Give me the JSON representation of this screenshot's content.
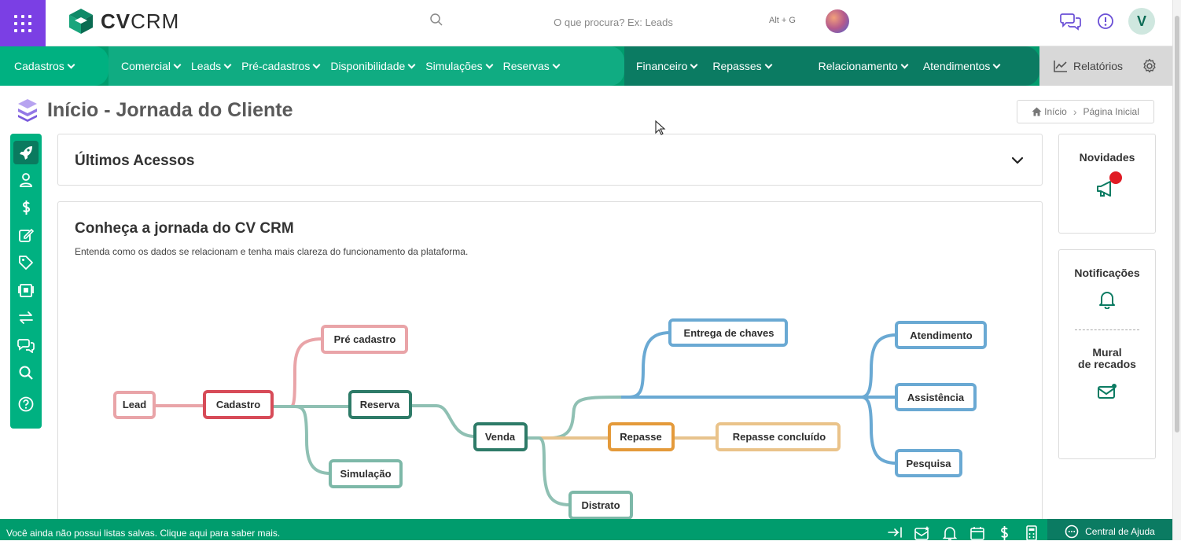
{
  "header": {
    "logo_text_bold": "CV",
    "logo_text": "CRM",
    "search_placeholder": "O que procura? Ex: Leads",
    "search_shortcut": "Alt + G",
    "user_initial": "V",
    "icons": [
      "apps-grid-icon",
      "search-icon",
      "chat-icon",
      "info-icon"
    ]
  },
  "nav": {
    "items": [
      {
        "label": "Cadastros"
      },
      {
        "label": "Comercial"
      },
      {
        "label": "Leads"
      },
      {
        "label": "Pré-cadastros"
      },
      {
        "label": "Disponibilidade"
      },
      {
        "label": "Simulações"
      },
      {
        "label": "Reservas"
      },
      {
        "label": "Financeiro"
      },
      {
        "label": "Repasses"
      },
      {
        "label": "Relacionamento"
      },
      {
        "label": "Atendimentos"
      }
    ],
    "reports_label": "Relatórios"
  },
  "page": {
    "title": "Início - Jornada do Cliente",
    "breadcrumb": {
      "home": "Início",
      "current": "Página Inicial"
    }
  },
  "sidebar_icons": [
    "rocket-icon",
    "user-icon",
    "dollar-icon",
    "edit-icon",
    "tag-icon",
    "id-card-icon",
    "transfer-icon",
    "chats-icon",
    "search-icon",
    "help-icon"
  ],
  "acessos": {
    "title": "Últimos Acessos"
  },
  "jornada": {
    "title": "Conheça a jornada do CV CRM",
    "subtitle": "Entenda como os dados se relacionam e tenha mais clareza do funcionamento da plataforma.",
    "nodes": {
      "lead": "Lead",
      "cadastro": "Cadastro",
      "pre_cadastro": "Pré cadastro",
      "reserva": "Reserva",
      "simulacao": "Simulação",
      "venda": "Venda",
      "entrega": "Entrega de chaves",
      "repasse": "Repasse",
      "repasse_concluido": "Repasse concluído",
      "distrato": "Distrato",
      "atendimento": "Atendimento",
      "assistencia": "Assistência",
      "pesquisa": "Pesquisa"
    }
  },
  "right_panel": {
    "novidades": "Novidades",
    "notificacoes": "Notificações",
    "mural": "Mural\nde recados",
    "mural_line1": "Mural",
    "mural_line2": "de recados"
  },
  "bottom": {
    "message": "Você ainda não possui listas salvas. Clique aqui para saber mais.",
    "help": "Central de Ajuda"
  },
  "colors": {
    "brand_green": "#009c6d",
    "dark_green": "#0b7b62",
    "purple": "#7b3fe4",
    "pink": "#e9969b",
    "red": "#d74b58",
    "teal": "#7db8a8",
    "dark_teal": "#2e7b68",
    "blue": "#6aa9d3",
    "orange": "#e49a3a",
    "light_orange": "#eac38a"
  }
}
